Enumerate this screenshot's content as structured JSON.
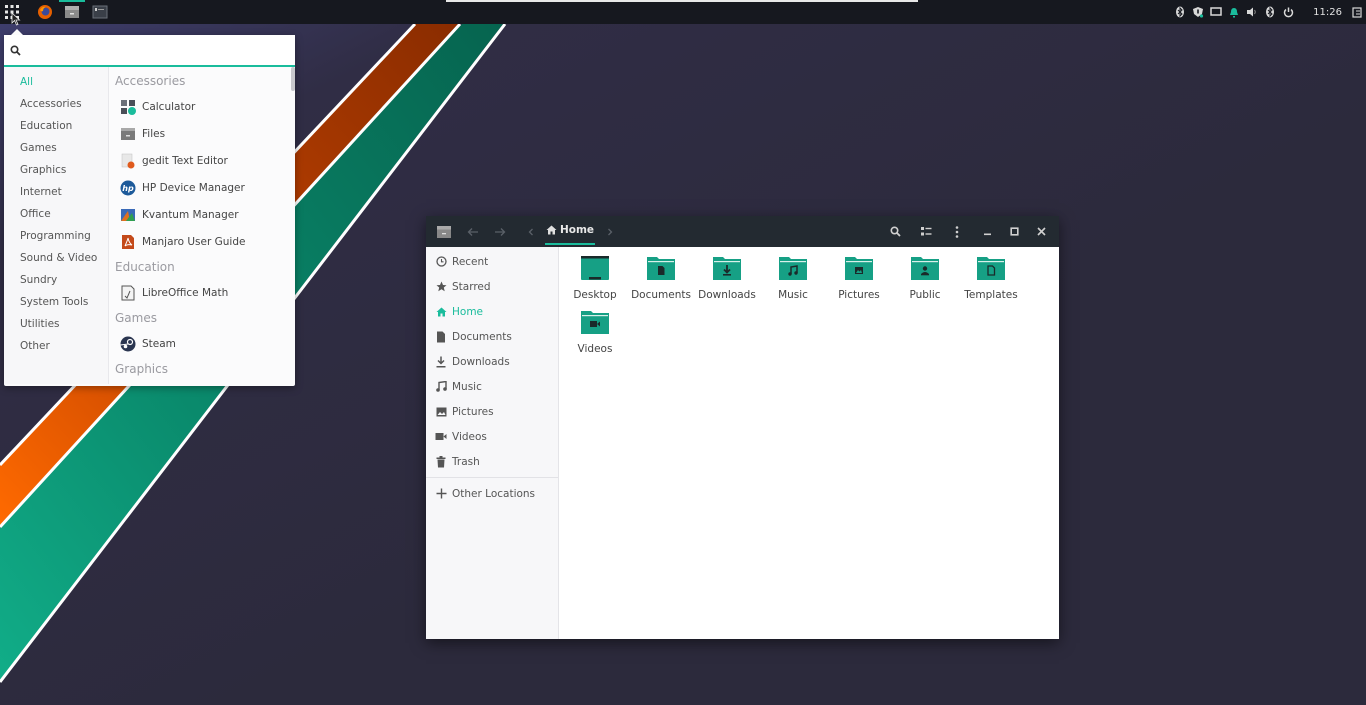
{
  "topbar": {
    "launchers": [
      {
        "name": "apps-grid-icon"
      },
      {
        "name": "firefox-icon"
      },
      {
        "name": "files-icon"
      },
      {
        "name": "terminal-icon"
      }
    ],
    "tray": [
      "bluetooth-icon",
      "shield-update-icon",
      "display-icon",
      "notification-bell-icon",
      "volume-icon",
      "bluetooth-icon",
      "power-icon"
    ],
    "clock": "11:26"
  },
  "app_menu": {
    "search": {
      "placeholder": "",
      "value": ""
    },
    "categories": [
      {
        "label": "All",
        "active": true
      },
      {
        "label": "Accessories"
      },
      {
        "label": "Education"
      },
      {
        "label": "Games"
      },
      {
        "label": "Graphics"
      },
      {
        "label": "Internet"
      },
      {
        "label": "Office"
      },
      {
        "label": "Programming"
      },
      {
        "label": "Sound & Video"
      },
      {
        "label": "Sundry"
      },
      {
        "label": "System Tools"
      },
      {
        "label": "Utilities"
      },
      {
        "label": "Other"
      }
    ],
    "sections": [
      {
        "title": "Accessories",
        "apps": [
          {
            "label": "Calculator",
            "icon": "calculator-icon"
          },
          {
            "label": "Files",
            "icon": "files-icon"
          },
          {
            "label": "gedit Text Editor",
            "icon": "gedit-icon"
          },
          {
            "label": "HP Device Manager",
            "icon": "hp-icon"
          },
          {
            "label": "Kvantum Manager",
            "icon": "kvantum-icon"
          },
          {
            "label": "Manjaro User Guide",
            "icon": "pdf-icon"
          }
        ]
      },
      {
        "title": "Education",
        "apps": [
          {
            "label": "LibreOffice Math",
            "icon": "libreoffice-math-icon"
          }
        ]
      },
      {
        "title": "Games",
        "apps": [
          {
            "label": "Steam",
            "icon": "steam-icon"
          }
        ]
      },
      {
        "title": "Graphics",
        "apps": []
      }
    ]
  },
  "file_manager": {
    "path": {
      "current": "Home"
    },
    "sidebar": [
      {
        "label": "Recent",
        "icon": "clock-icon"
      },
      {
        "label": "Starred",
        "icon": "star-icon"
      },
      {
        "label": "Home",
        "icon": "home-icon",
        "active": true
      },
      {
        "label": "Documents",
        "icon": "document-icon"
      },
      {
        "label": "Downloads",
        "icon": "download-icon"
      },
      {
        "label": "Music",
        "icon": "music-icon"
      },
      {
        "label": "Pictures",
        "icon": "picture-icon"
      },
      {
        "label": "Videos",
        "icon": "video-icon"
      },
      {
        "label": "Trash",
        "icon": "trash-icon"
      }
    ],
    "other_locations": {
      "label": "Other Locations",
      "icon": "plus-icon"
    },
    "folders": [
      {
        "label": "Desktop",
        "glyph": "desktop"
      },
      {
        "label": "Documents",
        "glyph": "document"
      },
      {
        "label": "Downloads",
        "glyph": "download"
      },
      {
        "label": "Music",
        "glyph": "music"
      },
      {
        "label": "Pictures",
        "glyph": "picture"
      },
      {
        "label": "Public",
        "glyph": "person"
      },
      {
        "label": "Templates",
        "glyph": "template"
      },
      {
        "label": "Videos",
        "glyph": "video"
      }
    ]
  },
  "colors": {
    "accent": "#1abc9c",
    "folder": "#16a085",
    "header": "#232a31",
    "stripe_orange": "#d35400",
    "stripe_green": "#0e9f7e",
    "desktop_bg": "#2c2a3c"
  }
}
